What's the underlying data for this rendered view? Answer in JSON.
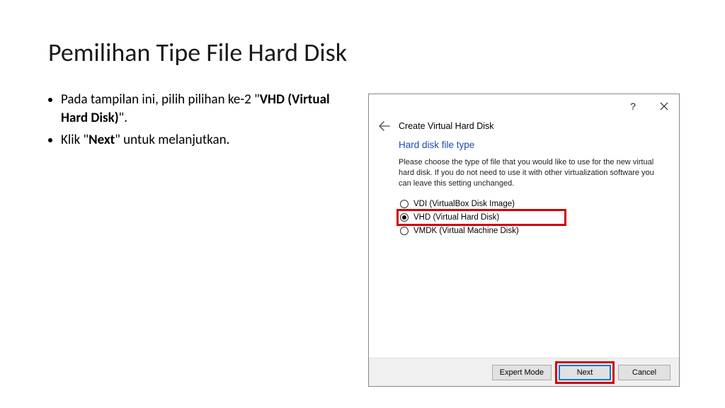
{
  "slide": {
    "title": "Pemilihan Tipe File Hard Disk",
    "bullet1_prefix": "Pada tampilan ini, pilih pilihan ke-2 \"",
    "bullet1_bold": "VHD (Virtual Hard Disk)",
    "bullet1_suffix": "\".",
    "bullet2_prefix": "Klik \"",
    "bullet2_bold": "Next",
    "bullet2_suffix": "\" untuk melanjutkan."
  },
  "dialog": {
    "help_label": "?",
    "heading": "Create Virtual Hard Disk",
    "section_title": "Hard disk file type",
    "description": "Please choose the type of file that you would like to use for the new virtual hard disk. If you do not need to use it with other virtualization software you can leave this setting unchanged.",
    "options": {
      "vdi": "VDI (VirtualBox Disk Image)",
      "vhd": "VHD (Virtual Hard Disk)",
      "vmdk": "VMDK (Virtual Machine Disk)"
    },
    "buttons": {
      "expert": "Expert Mode",
      "next": "Next",
      "cancel": "Cancel"
    }
  }
}
